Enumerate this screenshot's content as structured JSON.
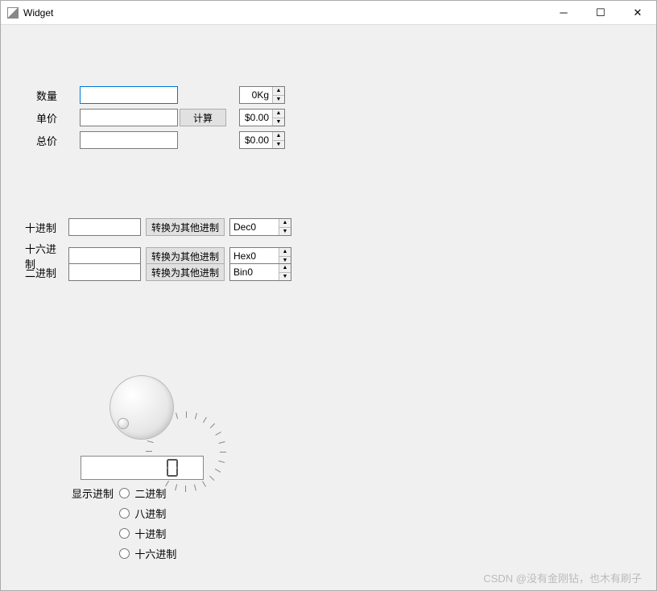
{
  "window": {
    "title": "Widget"
  },
  "price_section": {
    "qty_label": "数量",
    "qty_value": "",
    "unit_label": "单价",
    "unit_value": "",
    "total_label": "总价",
    "total_value": "",
    "calc_button": "计算",
    "spin_kg": "0Kg",
    "spin_price1": "$0.00",
    "spin_price2": "$0.00"
  },
  "base_section": {
    "dec_label": "十进制",
    "hex_label": "十六进制",
    "bin_label": "二进制",
    "convert_button": "转换为其他进制",
    "dec_spin": "Dec0",
    "hex_spin": "Hex0",
    "bin_spin": "Bin0",
    "dec_value": "",
    "hex_value": "",
    "bin_value": ""
  },
  "dial_section": {
    "lcd_value": "0",
    "radio_label": "显示进制",
    "radio_bin": "二进制",
    "radio_oct": "八进制",
    "radio_dec": "十进制",
    "radio_hex": "十六进制"
  },
  "watermark": "CSDN @没有金刚钻，也木有刷子"
}
